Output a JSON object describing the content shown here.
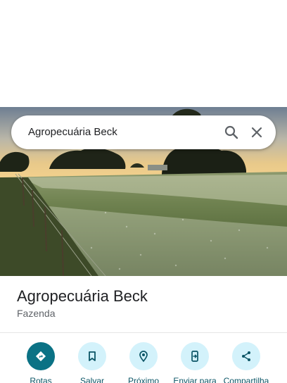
{
  "search": {
    "query": "Agropecuária Beck",
    "search_icon": "search-icon",
    "close_icon": "close-icon"
  },
  "place": {
    "title": "Agropecuária Beck",
    "category": "Fazenda"
  },
  "actions": [
    {
      "label": "Rotas",
      "icon": "directions-icon"
    },
    {
      "label": "Salvar",
      "icon": "bookmark-icon"
    },
    {
      "label": "Próximo",
      "icon": "nearby-icon"
    },
    {
      "label": "Enviar para",
      "icon": "send-to-phone-icon"
    },
    {
      "label": "Compartilha",
      "icon": "share-icon"
    }
  ],
  "colors": {
    "accent": "#0b7285",
    "action_bg": "#d3f2fb",
    "text_primary": "#202124",
    "text_secondary": "#5f6368"
  }
}
